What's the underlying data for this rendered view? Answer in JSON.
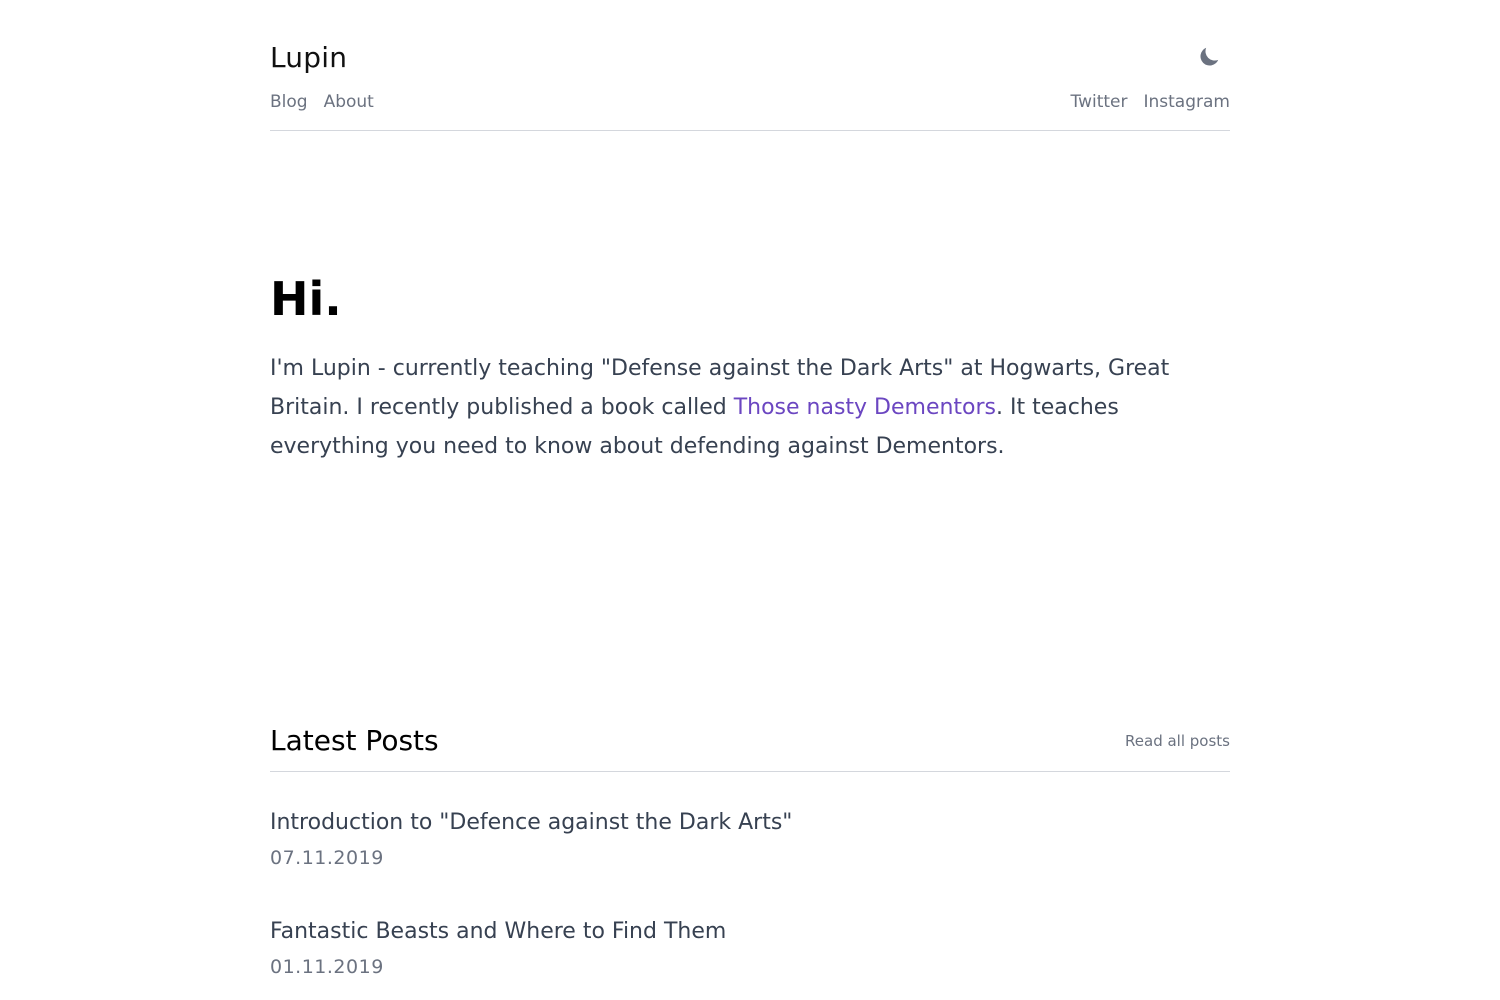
{
  "site": {
    "title": "Lupin",
    "theme_icon": "moon-icon"
  },
  "nav": {
    "left": [
      {
        "label": "Blog"
      },
      {
        "label": "About"
      }
    ],
    "right": [
      {
        "label": "Twitter"
      },
      {
        "label": "Instagram"
      }
    ]
  },
  "hero": {
    "heading": "Hi.",
    "text_before_link": "I'm Lupin - currently teaching \"Defense against the Dark Arts\" at Hogwarts, Great Britain. I recently published a book called ",
    "link_text": "Those nasty Dementors",
    "text_after_link": ". It teaches everything you need to know about defending against Dementors.",
    "link_color": "#6b46c1"
  },
  "posts": {
    "heading": "Latest Posts",
    "read_all_label": "Read all posts",
    "items": [
      {
        "title": "Introduction to \"Defence against the Dark Arts\"",
        "date": "07.11.2019"
      },
      {
        "title": "Fantastic Beasts and Where to Find Them",
        "date": "01.11.2019"
      }
    ]
  }
}
